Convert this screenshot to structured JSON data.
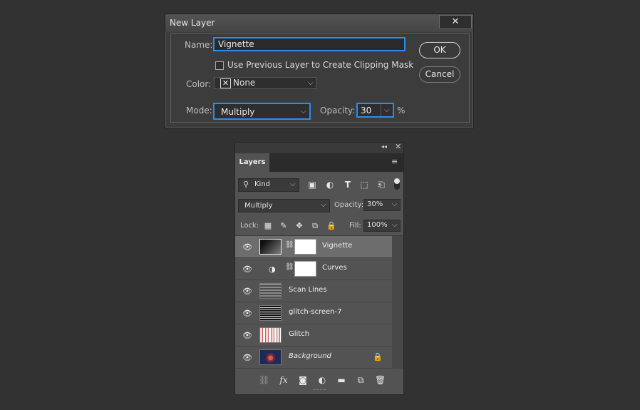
{
  "dialog": {
    "title": "New Layer",
    "close_glyph": "✕",
    "name_label": "Name:",
    "name_value": "Vignette",
    "clip_checkbox_label": "Use Previous Layer to Create Clipping Mask",
    "clip_checked": false,
    "color_label": "Color:",
    "color_value": "None",
    "mode_label": "Mode:",
    "mode_value": "Multiply",
    "opacity_label": "Opacity:",
    "opacity_value": "30",
    "opacity_unit": "%",
    "ok_label": "OK",
    "cancel_label": "Cancel",
    "accent_color": "#2d8ceb"
  },
  "layers_panel": {
    "tab_label": "Layers",
    "filter_kind": "Kind",
    "blend_mode": "Multiply",
    "opacity_label": "Opacity:",
    "opacity_value": "30%",
    "lock_label": "Lock:",
    "fill_label": "Fill:",
    "fill_value": "100%",
    "layers": [
      {
        "name": "Vignette",
        "selected": true,
        "has_mask": true,
        "thumb": "gradient"
      },
      {
        "name": "Curves",
        "selected": false,
        "has_mask": true,
        "thumb": "adjustment"
      },
      {
        "name": "Scan Lines",
        "selected": false,
        "has_mask": false,
        "thumb": "stripes"
      },
      {
        "name": "glitch-screen-7",
        "selected": false,
        "has_mask": false,
        "thumb": "glitch-bw"
      },
      {
        "name": "Glitch",
        "selected": false,
        "has_mask": false,
        "thumb": "glitch-color"
      },
      {
        "name": "Background",
        "selected": false,
        "has_mask": false,
        "thumb": "photo",
        "italic": true,
        "locked": true
      }
    ],
    "bottom_icons": [
      "link-icon",
      "fx-icon",
      "mask-icon",
      "adjustment-icon",
      "folder-icon",
      "new-layer-icon",
      "trash-icon"
    ]
  }
}
